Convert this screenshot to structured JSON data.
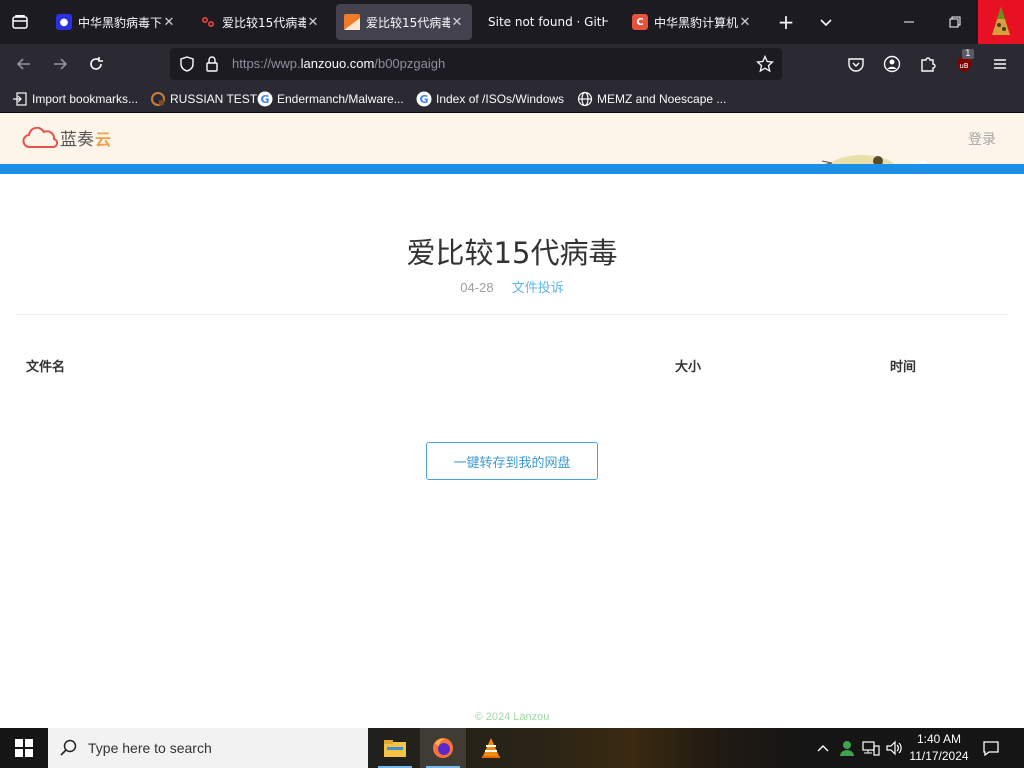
{
  "browser": {
    "tabs": [
      {
        "title": "中华黑豹病毒下",
        "favicon": "baidu-paw-icon",
        "favicon_color": "#2932e1",
        "active": false
      },
      {
        "title": "爱比较15代病毒",
        "favicon": "bilibili-icon",
        "favicon_color": "#1c1b22",
        "active": false
      },
      {
        "title": "爱比较15代病毒",
        "favicon": "lanzou-icon",
        "favicon_color": "#f07a28",
        "active": true
      },
      {
        "title": "Site not found · GitH",
        "favicon": "",
        "favicon_color": "",
        "active": false
      },
      {
        "title": "中华黑豹计算机",
        "favicon": "c-letter-icon",
        "favicon_color": "#e5533c",
        "active": false
      }
    ],
    "url": {
      "prefix": "https://wwp.",
      "domain": "lanzouo.com",
      "path": "/b00pzgaigh"
    },
    "extension_badge": "1",
    "bookmarks": [
      {
        "label": "Import bookmarks...",
        "icon": "import-icon"
      },
      {
        "label": "RUSSIAN TEST",
        "icon": "russian-test-icon"
      },
      {
        "label": "Endermanch/Malware...",
        "icon": "google-icon"
      },
      {
        "label": "Index of /ISOs/Windows",
        "icon": "google-icon"
      },
      {
        "label": "MEMZ and Noescape ...",
        "icon": "globe-icon"
      }
    ]
  },
  "site": {
    "logo_text": "蓝奏",
    "logo_cloud_char": "云",
    "login": "登录",
    "file_title": "爱比较15代病毒",
    "date": "04-28",
    "report_link": "文件投诉",
    "columns": {
      "name": "文件名",
      "size": "大小",
      "time": "时间"
    },
    "save_button": "一键转存到我的网盘",
    "footer": "© 2024 Lanzou",
    "accent_color": "#1c8fe6"
  },
  "taskbar": {
    "search_placeholder": "Type here to search",
    "apps": [
      "file-explorer-icon",
      "firefox-icon",
      "vlc-icon"
    ],
    "time": "1:40 AM",
    "date": "11/17/2024"
  }
}
